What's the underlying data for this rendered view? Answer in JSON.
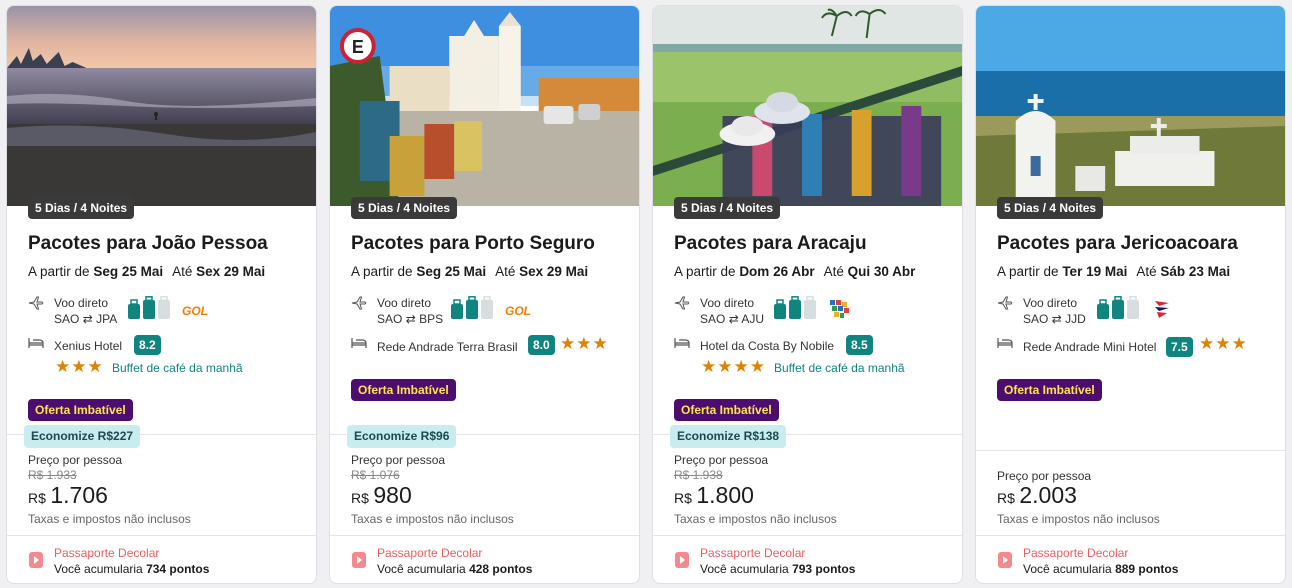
{
  "cards": [
    {
      "nights": "5 Dias / 4 Noites",
      "title": "Pacotes para João Pessoa",
      "from_label": "A partir de",
      "from_date": "Seg 25 Mai",
      "to_label": "Até",
      "to_date": "Sex 29 Mai",
      "flight_type": "Voo direto",
      "route_from": "SAO",
      "route_to": "JPA",
      "airline": "GOL",
      "hotel_name": "Xenius Hotel",
      "score": "8.2",
      "stars": "★★★",
      "breakfast": "Buffet de café da manhã",
      "promo": "Oferta Imbatível",
      "saving": "Economize R$227",
      "price_label": "Preço por pessoa",
      "old_price": "R$ 1.933",
      "currency": "R$",
      "price": "1.706",
      "taxes": "Taxas e impostos não inclusos",
      "passport_title": "Passaporte Decolar",
      "points_prefix": "Você acumularia",
      "points": "734 pontos"
    },
    {
      "nights": "5 Dias / 4 Noites",
      "title": "Pacotes para Porto Seguro",
      "from_label": "A partir de",
      "from_date": "Seg 25 Mai",
      "to_label": "Até",
      "to_date": "Sex 29 Mai",
      "flight_type": "Voo direto",
      "route_from": "SAO",
      "route_to": "BPS",
      "airline": "GOL",
      "hotel_name": "Rede Andrade Terra Brasil",
      "score": "8.0",
      "stars": "★★★",
      "promo": "Oferta Imbatível",
      "saving": "Economize R$96",
      "price_label": "Preço por pessoa",
      "old_price": "R$ 1.076",
      "currency": "R$",
      "price": "980",
      "taxes": "Taxas e impostos não inclusos",
      "passport_title": "Passaporte Decolar",
      "points_prefix": "Você acumularia",
      "points": "428 pontos"
    },
    {
      "nights": "5 Dias / 4 Noites",
      "title": "Pacotes para Aracaju",
      "from_label": "A partir de",
      "from_date": "Dom 26 Abr",
      "to_label": "Até",
      "to_date": "Qui 30 Abr",
      "flight_type": "Voo direto",
      "route_from": "SAO",
      "route_to": "AJU",
      "airline": "Azul",
      "hotel_name": "Hotel da Costa By Nobile",
      "score": "8.5",
      "stars": "★★★★",
      "breakfast": "Buffet de café da manhã",
      "promo": "Oferta Imbatível",
      "saving": "Economize R$138",
      "price_label": "Preço por pessoa",
      "old_price": "R$ 1.938",
      "currency": "R$",
      "price": "1.800",
      "taxes": "Taxas e impostos não inclusos",
      "passport_title": "Passaporte Decolar",
      "points_prefix": "Você acumularia",
      "points": "793 pontos"
    },
    {
      "nights": "5 Dias / 4 Noites",
      "title": "Pacotes para Jericoacoara",
      "from_label": "A partir de",
      "from_date": "Ter 19 Mai",
      "to_label": "Até",
      "to_date": "Sáb 23 Mai",
      "flight_type": "Voo direto",
      "route_from": "SAO",
      "route_to": "JJD",
      "airline": "LATAM",
      "hotel_name": "Rede Andrade Mini Hotel",
      "score": "7.5",
      "stars": "★★★",
      "promo": "Oferta Imbatível",
      "price_label": "Preço por pessoa",
      "currency": "R$",
      "price": "2.003",
      "taxes": "Taxas e impostos não inclusos",
      "passport_title": "Passaporte Decolar",
      "points_prefix": "Você acumularia",
      "points": "889 pontos"
    }
  ]
}
